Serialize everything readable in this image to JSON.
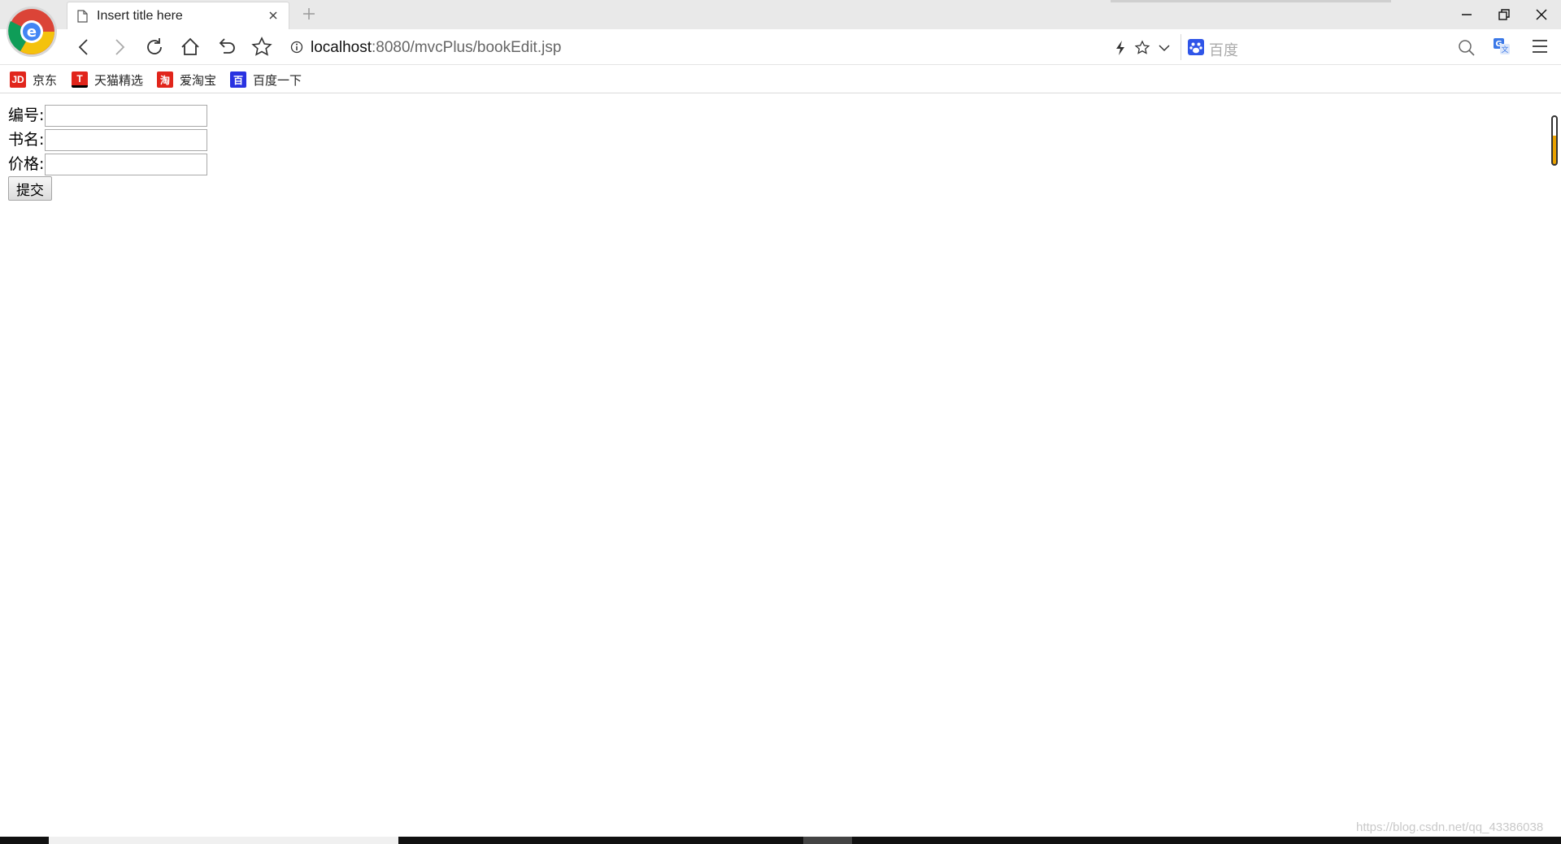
{
  "browser": {
    "tab": {
      "title": "Insert title here"
    },
    "address": {
      "host": "localhost",
      "rest": ":8080/mvcPlus/bookEdit.jsp"
    },
    "search": {
      "placeholder": "百度"
    }
  },
  "bookmarks": [
    {
      "icon": "jd-icon",
      "icon_text": "JD",
      "color": "#e1251b",
      "label": "京东"
    },
    {
      "icon": "tmall-icon",
      "icon_text": "T",
      "color": "#e1251b",
      "label": "天猫精选"
    },
    {
      "icon": "taobao-icon",
      "icon_text": "淘",
      "color": "#e1251b",
      "label": "爱淘宝"
    },
    {
      "icon": "baidu-icon",
      "icon_text": "百",
      "color": "#2932e1",
      "label": "百度一下"
    }
  ],
  "form": {
    "id_label": "编号:",
    "name_label": "书名:",
    "price_label": "价格:",
    "id_value": "",
    "name_value": "",
    "price_value": "",
    "submit_label": "提交"
  },
  "watermark": "https://blog.csdn.net/qq_43386038"
}
